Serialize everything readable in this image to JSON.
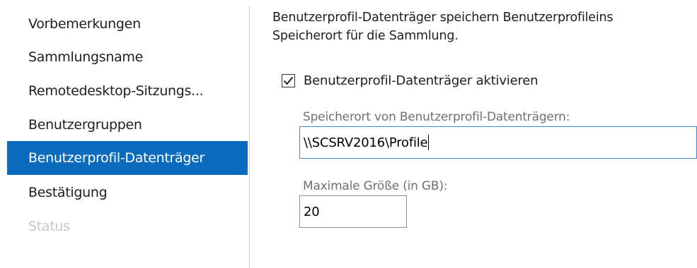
{
  "nav": {
    "items": [
      {
        "label": "Vorbemerkungen",
        "state": "normal"
      },
      {
        "label": "Sammlungsname",
        "state": "normal"
      },
      {
        "label": "Remotedesktop-Sitzungs...",
        "state": "normal"
      },
      {
        "label": "Benutzergruppen",
        "state": "normal"
      },
      {
        "label": "Benutzerprofil-Datenträger",
        "state": "active"
      },
      {
        "label": "Bestätigung",
        "state": "normal"
      },
      {
        "label": "Status",
        "state": "disabled"
      }
    ]
  },
  "content": {
    "description_line1": "Benutzerprofil-Datenträger speichern Benutzerprofileins",
    "description_line2": "Speicherort für die Sammlung.",
    "enable_checkbox": {
      "label": "Benutzerprofil-Datenträger aktivieren",
      "checked": true
    },
    "location_field": {
      "label": "Speicherort von Benutzerprofil-Datenträgern:",
      "value": "\\\\SCSRV2016\\Profile"
    },
    "size_field": {
      "label": "Maximale Größe (in GB):",
      "value": "20"
    }
  },
  "colors": {
    "accent": "#0b6cbe",
    "disabled_text": "#c7c7c7",
    "field_label": "#707070",
    "focus_border": "#3d88d6"
  }
}
